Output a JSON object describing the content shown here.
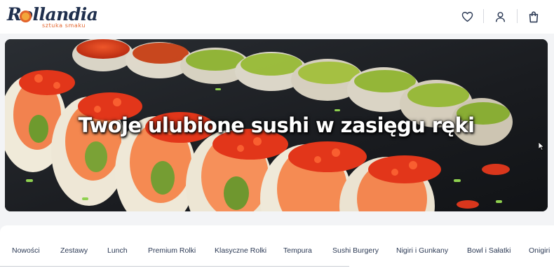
{
  "brand": {
    "name": "Rollandia",
    "tagline": "sztuka smaku"
  },
  "header_icons": [
    "heart-icon",
    "user-icon",
    "shopping-bag-icon"
  ],
  "hero": {
    "title": "Twoje ulubione sushi w zasięgu ręki"
  },
  "categories": [
    "Nowości",
    "Zestawy",
    "Lunch",
    "Premium Rolki",
    "Klasyczne Rolki",
    "Tempura",
    "Sushi Burgery",
    "Nigiri i Gunkany",
    "Bowl i Sałatki",
    "Onigiri"
  ],
  "colors": {
    "brand_navy": "#1f2f4d",
    "brand_orange": "#e2632b",
    "nav_text": "#2c3a55"
  }
}
